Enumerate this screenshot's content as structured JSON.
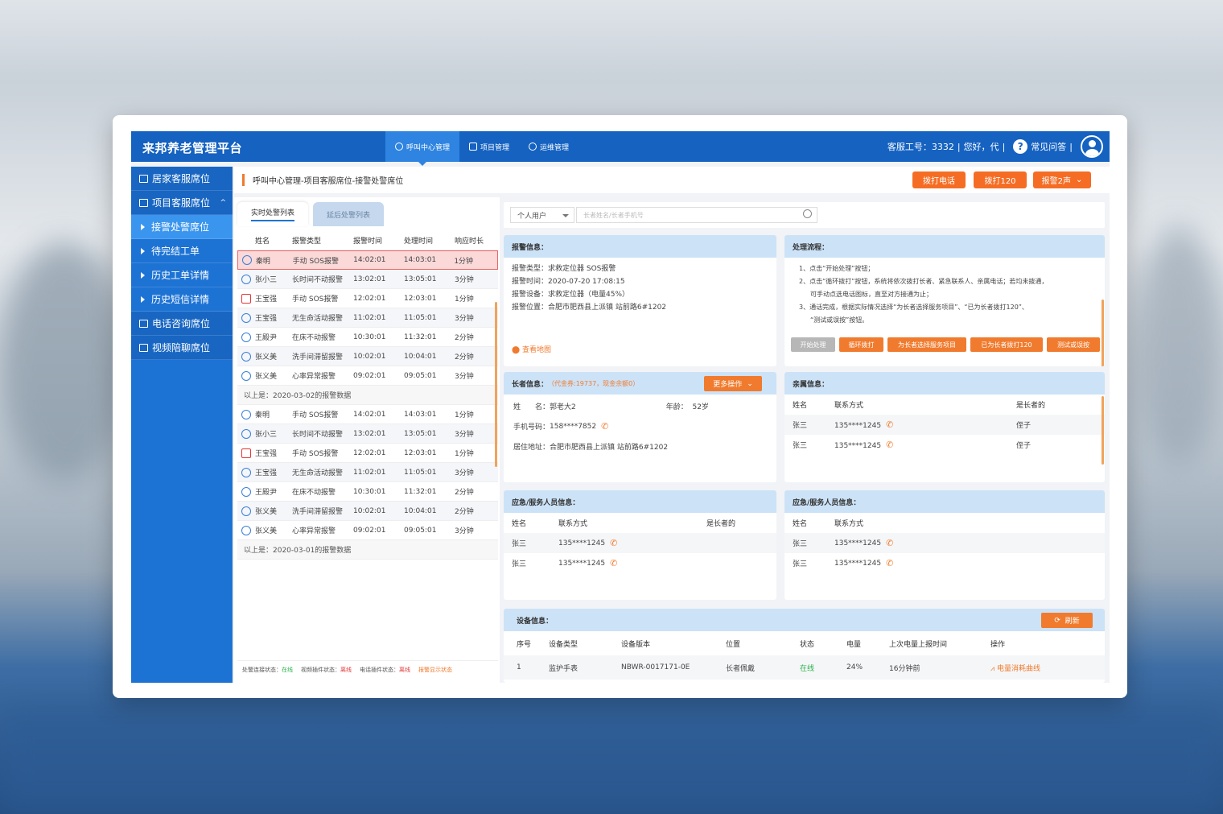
{
  "app": {
    "title": "来邦养老管理平台"
  },
  "topnav": [
    {
      "label": "呼叫中心管理",
      "icon": "headset-icon"
    },
    {
      "label": "项目管理",
      "icon": "folder-icon"
    },
    {
      "label": "运维管理",
      "icon": "gear-icon"
    }
  ],
  "header": {
    "agent_label": "客服工号：3332",
    "greeting": "您好，代",
    "help": "常见问答",
    "sep": "|"
  },
  "sidebar": [
    {
      "label": "居家客服席位",
      "type": "top"
    },
    {
      "label": "项目客服席位",
      "type": "top",
      "caret": "^"
    },
    {
      "label": "接警处警席位",
      "type": "sub",
      "active": true
    },
    {
      "label": "待完结工单",
      "type": "sub"
    },
    {
      "label": "历史工单详情",
      "type": "sub"
    },
    {
      "label": "历史短信详情",
      "type": "sub"
    },
    {
      "label": "电话咨询席位",
      "type": "top"
    },
    {
      "label": "视频陪聊席位",
      "type": "top"
    }
  ],
  "breadcrumb": "呼叫中心管理-项目客服席位-接警处警席位",
  "actions": {
    "call": "拨打电话",
    "call120": "拨打120",
    "alarm": "报警2声"
  },
  "left_tabs": {
    "active": "实时处警列表",
    "inactive": "延后处警列表"
  },
  "alarm_table": {
    "headers": [
      "姓名",
      "报警类型",
      "报警时间",
      "处理时间",
      "响应时长"
    ],
    "group1": [
      {
        "name": "秦明",
        "type": "手动 SOS报警",
        "t1": "14:02:01",
        "t2": "14:03:01",
        "dur": "1分钟",
        "icon": "sos-watch-icon"
      },
      {
        "name": "张小三",
        "type": "长时间不动报警",
        "t1": "13:02:01",
        "t2": "13:05:01",
        "dur": "3分钟",
        "icon": "clock-icon"
      },
      {
        "name": "王宝强",
        "type": "手动 SOS报警",
        "t1": "12:02:01",
        "t2": "12:03:01",
        "dur": "1分钟",
        "icon": "sos-icon"
      },
      {
        "name": "王宝强",
        "type": "无生命活动报警",
        "t1": "11:02:01",
        "t2": "11:05:01",
        "dur": "3分钟",
        "icon": "home-icon"
      },
      {
        "name": "王殿尹",
        "type": "在床不动报警",
        "t1": "10:30:01",
        "t2": "11:32:01",
        "dur": "2分钟",
        "icon": "bed-icon"
      },
      {
        "name": "张义美",
        "type": "洗手间滞留报警",
        "t1": "10:02:01",
        "t2": "10:04:01",
        "dur": "2分钟",
        "icon": "restroom-icon"
      },
      {
        "name": "张义美",
        "type": "心率异常报警",
        "t1": "09:02:01",
        "t2": "09:05:01",
        "dur": "3分钟",
        "icon": "heart-icon"
      }
    ],
    "note1": "以上是：2020-03-02的报警数据",
    "group2": [
      {
        "name": "秦明",
        "type": "手动 SOS报警",
        "t1": "14:02:01",
        "t2": "14:03:01",
        "dur": "1分钟",
        "icon": "sos-watch-icon"
      },
      {
        "name": "张小三",
        "type": "长时间不动报警",
        "t1": "13:02:01",
        "t2": "13:05:01",
        "dur": "3分钟",
        "icon": "clock-icon"
      },
      {
        "name": "王宝强",
        "type": "手动 SOS报警",
        "t1": "12:02:01",
        "t2": "12:03:01",
        "dur": "1分钟",
        "icon": "sos-icon"
      },
      {
        "name": "王宝强",
        "type": "无生命活动报警",
        "t1": "11:02:01",
        "t2": "11:05:01",
        "dur": "3分钟",
        "icon": "home-icon"
      },
      {
        "name": "王殿尹",
        "type": "在床不动报警",
        "t1": "10:30:01",
        "t2": "11:32:01",
        "dur": "2分钟",
        "icon": "bed-icon"
      },
      {
        "name": "张义美",
        "type": "洗手间滞留报警",
        "t1": "10:02:01",
        "t2": "10:04:01",
        "dur": "2分钟",
        "icon": "restroom-icon"
      },
      {
        "name": "张义美",
        "type": "心率异常报警",
        "t1": "09:02:01",
        "t2": "09:05:01",
        "dur": "3分钟",
        "icon": "heart-icon"
      }
    ],
    "note2": "以上是：2020-03-01的报警数据"
  },
  "status": {
    "s1": "处警连接状态：",
    "v1": "在线",
    "s2": "视频插件状态：",
    "v2": "离线",
    "s3": "电话插件状态：",
    "v3": "离线",
    "s4": "报警显示状态"
  },
  "search": {
    "select": "个人用户",
    "placeholder": "长者姓名/长者手机号"
  },
  "alarm_info": {
    "title": "报警信息：",
    "type": "报警类型：求救定位器 SOS报警",
    "time": "报警时间：2020-07-20 17:08:15",
    "device": "报警设备：求救定位器（电量45%）",
    "location": "报警位置：合肥市肥西县上派镇 站前路6#1202",
    "map": "查看地图"
  },
  "process": {
    "title": "处理流程：",
    "l1": "1、点击“开始处理”按钮；",
    "l2": "2、点击“循环拨打”按钮，系统将依次拨打长者、紧急联系人、亲属电话；若均未拨通，",
    "l2b": "可手动点选电话图标，直至对方接通为止；",
    "l3": "3、通话完成，根据实际情况选择“为长者选择服务项目”、“已为长者拨打120”、",
    "l3b": "“测试或误按”按钮。",
    "b1": "开始处理",
    "b2": "循环拨打",
    "b3": "为长者选择服务项目",
    "b4": "已为长者拨打120",
    "b5": "测试或误按"
  },
  "elder": {
    "title": "长者信息：",
    "balance": "（代金券:19737，现金余额0）",
    "more": "更多操作",
    "name_label": "姓　　名：",
    "name": "郭老大2",
    "age_label": "年龄：",
    "age": "52岁",
    "phone_label": "手机号码：",
    "phone": "158****7852",
    "addr_label": "居住地址：",
    "addr": "合肥市肥西县上派镇 站前路6#1202"
  },
  "relatives": {
    "title": "亲属信息：",
    "h": [
      "姓名",
      "联系方式",
      "是长者的"
    ],
    "rows": [
      [
        "张三",
        "135****1245",
        "侄子"
      ],
      [
        "张三",
        "135****1245",
        "侄子"
      ]
    ]
  },
  "staff1": {
    "title": "应急/服务人员信息：",
    "h": [
      "姓名",
      "联系方式",
      "是长者的"
    ],
    "rows": [
      [
        "张三",
        "135****1245"
      ],
      [
        "张三",
        "135****1245"
      ]
    ]
  },
  "staff2": {
    "title": "应急/服务人员信息：",
    "h": [
      "姓名",
      "联系方式"
    ],
    "rows": [
      [
        "张三",
        "135****1245"
      ],
      [
        "张三",
        "135****1245"
      ]
    ]
  },
  "device": {
    "title": "设备信息：",
    "refresh": "刷新",
    "h": [
      "序号",
      "设备类型",
      "设备版本",
      "位置",
      "状态",
      "电量",
      "上次电量上报时间",
      "操作"
    ],
    "row": [
      "1",
      "监护手表",
      "NBWR-0017171-0E",
      "长者佩戴",
      "在线",
      "24%",
      "16分钟前",
      "电量消耗曲线"
    ]
  }
}
